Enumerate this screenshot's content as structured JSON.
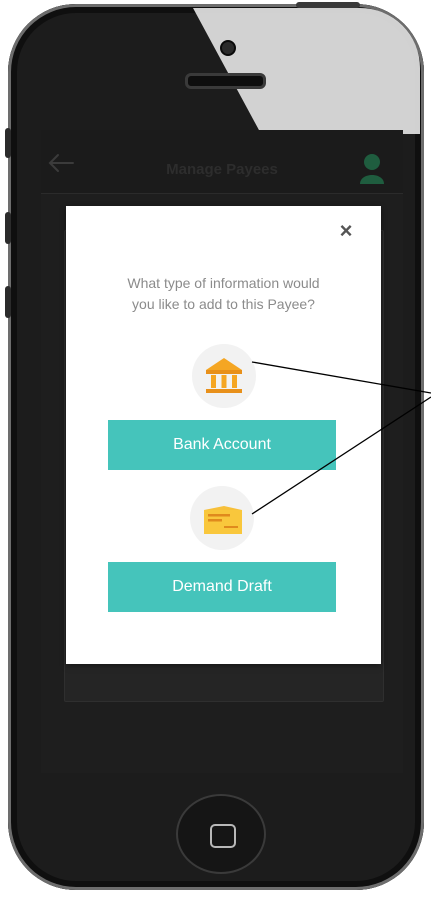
{
  "app": {
    "title": "Manage Payees"
  },
  "dialog": {
    "question_line1": "What type of information would",
    "question_line2": "you like to add to this Payee?",
    "close_label": "×",
    "options": [
      {
        "label": "Bank Account",
        "icon": "bank-icon"
      },
      {
        "label": "Demand Draft",
        "icon": "draft-icon"
      }
    ]
  },
  "colors": {
    "accent": "#45c4bb",
    "bank_icon": "#f5a623",
    "draft_icon": "#f7c03a"
  },
  "icons": {
    "back": "arrow-left-icon",
    "avatar": "user-avatar-icon",
    "home": "home-button-icon"
  }
}
